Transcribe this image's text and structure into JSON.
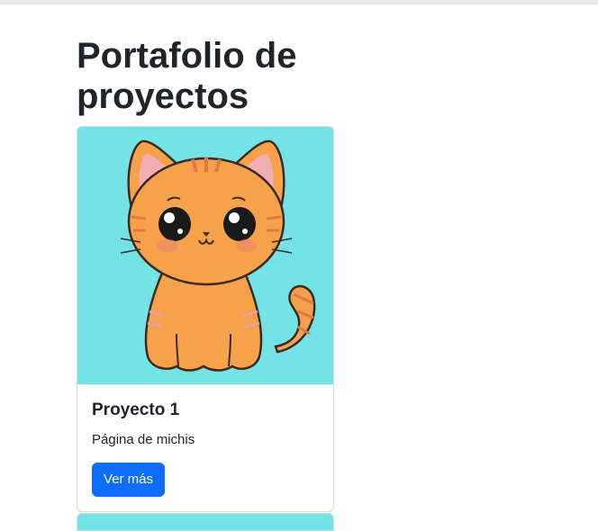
{
  "page": {
    "title": "Portafolio de proyectos"
  },
  "projects": [
    {
      "title": "Proyecto 1",
      "description": "Página de michis",
      "button_label": "Ver más",
      "image_alt": "cartoon-orange-cat"
    }
  ],
  "colors": {
    "primary": "#0d6efd",
    "image_background": "#74e3e6",
    "cat_orange": "#f7a14a",
    "text": "#212529"
  }
}
